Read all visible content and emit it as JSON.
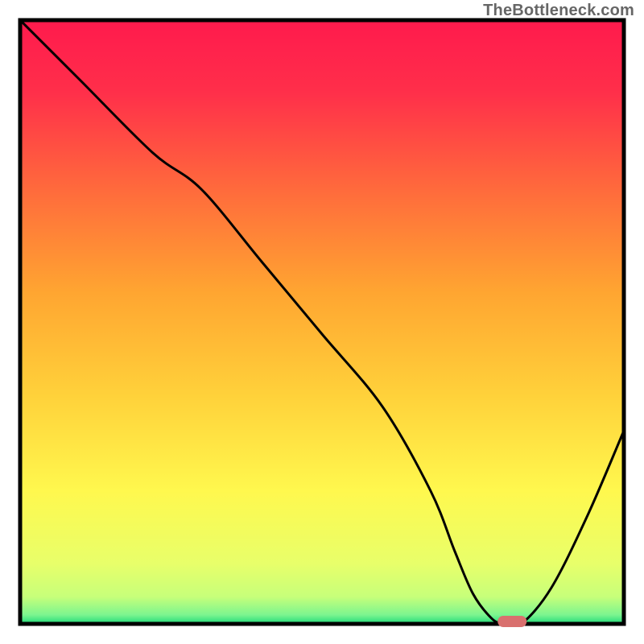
{
  "attribution": "TheBottleneck.com",
  "chart_data": {
    "type": "line",
    "title": "",
    "xlabel": "",
    "ylabel": "",
    "xlim": [
      0,
      100
    ],
    "ylim": [
      0,
      100
    ],
    "series": [
      {
        "name": "curve",
        "x": [
          0,
          10,
          22,
          30,
          40,
          50,
          60,
          68,
          72,
          75,
          78,
          80,
          83,
          88,
          94,
          100
        ],
        "y": [
          100,
          90,
          78,
          72,
          60,
          48,
          36,
          22,
          12,
          5,
          1,
          0,
          0,
          6,
          18,
          32
        ]
      }
    ],
    "marker": {
      "x": 81.5,
      "y": 0
    },
    "gradient_stops": [
      {
        "offset": 0.0,
        "color": "#ff1a4d"
      },
      {
        "offset": 0.12,
        "color": "#ff2f4a"
      },
      {
        "offset": 0.28,
        "color": "#ff6a3c"
      },
      {
        "offset": 0.45,
        "color": "#ffa531"
      },
      {
        "offset": 0.62,
        "color": "#ffd13a"
      },
      {
        "offset": 0.78,
        "color": "#fff84e"
      },
      {
        "offset": 0.9,
        "color": "#e8ff6a"
      },
      {
        "offset": 0.955,
        "color": "#c7ff7a"
      },
      {
        "offset": 0.985,
        "color": "#7cf58f"
      },
      {
        "offset": 1.0,
        "color": "#1fd97a"
      }
    ]
  }
}
